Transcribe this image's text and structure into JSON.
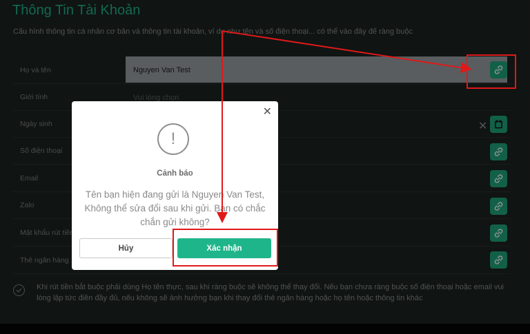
{
  "page": {
    "title": "Thông Tin Tài Khoản",
    "subtitle": "Cấu hình thông tin cá nhân cơ bản và thông tin tài khoản, ví dụ như tên và số điện thoại... có thể vào đây để ràng buộc"
  },
  "form": {
    "rows": [
      {
        "label": "Họ và tên",
        "value": "Nguyen Van Test"
      },
      {
        "label": "Giới tính",
        "placeholder": "Vui lòng chọn"
      },
      {
        "label": "Ngày sinh"
      },
      {
        "label": "Số điện thoại"
      },
      {
        "label": "Email"
      },
      {
        "label": "Zalo"
      },
      {
        "label": "Mật khẩu rút tiền"
      },
      {
        "label": "Thẻ ngân hàng"
      }
    ],
    "agreement": "Khi rút tiền bắt buộc phải dùng Họ tên thực, sau khi ràng buộc sẽ không thể thay đổi. Nếu bạn chưa ràng buộc số điện thoại hoặc email vui lòng lập tức điền đầy đủ, nếu không sẽ ảnh hưởng bạn khi thay đổi thẻ ngân hàng hoặc họ tên hoặc thông tin khác"
  },
  "dialog": {
    "title": "Cảnh báo",
    "message": "Tên bạn hiện đang gửi là Nguyen Van Test, Không thể sửa đổi sau khi gửi. Bạn có chắc chắn gửi không?",
    "cancel_label": "Hủy",
    "confirm_label": "Xác nhận",
    "close_icon": "close-icon",
    "warning_icon": "exclamation-icon"
  },
  "icons": {
    "link": "link-icon",
    "calendar": "calendar-icon",
    "clear": "close-icon",
    "agree": "check-circle-icon"
  },
  "colors": {
    "accent": "#1fb58a",
    "panel": "#1d2321",
    "annotation": "#e01919"
  }
}
